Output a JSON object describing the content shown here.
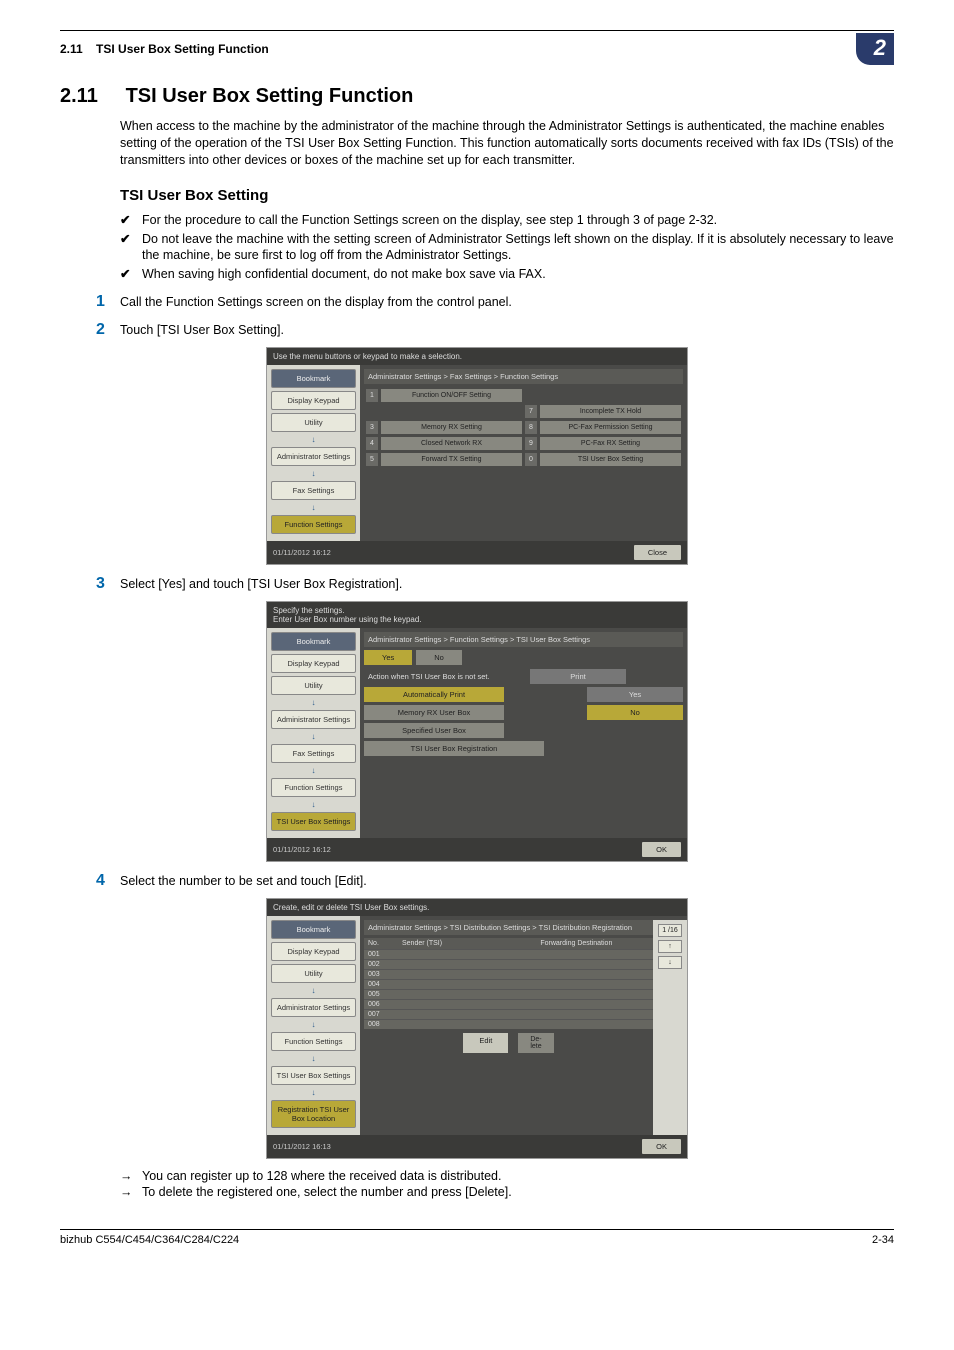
{
  "header": {
    "section_ref": "2.11",
    "section_name": "TSI User Box Setting Function",
    "chapter_badge": "2"
  },
  "title": {
    "number": "2.11",
    "text": "TSI User Box Setting Function"
  },
  "intro": "When access to the machine by the administrator of the machine through the Administrator Settings is authenticated, the machine enables setting of the operation of the TSI User Box Setting Function. This function automatically sorts documents received with fax IDs (TSIs) of the transmitters into other devices or boxes of the machine set up for each transmitter.",
  "subheading": "TSI User Box Setting",
  "checks": [
    "For the procedure to call the Function Settings screen on the display, see step 1 through 3 of page 2-32.",
    "Do not leave the machine with the setting screen of Administrator Settings left shown on the display. If it is absolutely necessary to leave the machine, be sure first to log off from the Administrator Settings.",
    "When saving high confidential document, do not make box save via FAX."
  ],
  "steps": {
    "s1": {
      "num": "1",
      "text": "Call the Function Settings screen on the display from the control panel."
    },
    "s2": {
      "num": "2",
      "text": "Touch [TSI User Box Setting]."
    },
    "s3": {
      "num": "3",
      "text": "Select [Yes] and touch [TSI User Box Registration]."
    },
    "s4": {
      "num": "4",
      "text": "Select the number to be set and touch [Edit]."
    }
  },
  "arrows": [
    "You can register up to 128 where the received data is distributed.",
    "To delete the registered one, select the number and press [Delete]."
  ],
  "ss1": {
    "top": "Use the menu buttons or keypad to make a selection.",
    "breadcrumb": "Administrator Settings > Fax Settings > Function Settings",
    "side": [
      "Bookmark",
      "Display Keypad",
      "Utility",
      "Administrator Settings",
      "Fax Settings",
      "Function Settings"
    ],
    "cells": {
      "c1": "Function ON/OFF Setting",
      "c2": "",
      "c3": "",
      "c7": "Incomplete TX Hold",
      "c4": "Memory RX Setting",
      "c8": "PC-Fax Permission Setting",
      "c5": "Closed Network RX",
      "c9": "PC-Fax RX Setting",
      "c6": "Forward TX Setting",
      "c0": "TSI User Box Setting"
    },
    "datetime": "01/11/2012   16:12",
    "close": "Close"
  },
  "ss2": {
    "top": "Specify the settings.\nEnter User Box number using the keypad.",
    "breadcrumb": "Administrator Settings > Function Settings > TSI User Box Settings",
    "side": [
      "Bookmark",
      "Display Keypad",
      "Utility",
      "Administrator Settings",
      "Fax Settings",
      "Function Settings",
      "TSI User Box Settings"
    ],
    "tabs": {
      "yes": "Yes",
      "no": "No"
    },
    "rows": {
      "r1_label": "Action when TSI User Box is not set.",
      "r1_val": "Print",
      "r2_btn": "Automatically Print",
      "r2_val": "Yes",
      "r3_btn": "Memory RX User Box",
      "r3_val": "No",
      "r4_btn": "Specified User Box",
      "r5_btn": "TSI User Box Registration"
    },
    "datetime": "01/11/2012   16:12",
    "ok": "OK"
  },
  "ss3": {
    "top": "Create, edit or delete TSI User Box settings.",
    "breadcrumb": "Administrator Settings > TSI Distribution Settings > TSI Distribution Registration",
    "side": [
      "Bookmark",
      "Display Keypad",
      "Utility",
      "Administrator Settings",
      "Function Settings",
      "TSI User Box Settings",
      "Registration TSI User Box Location"
    ],
    "thead": {
      "no": "No.",
      "sender": "Sender (TSI)",
      "dest": "Forwarding Destination"
    },
    "rows": [
      "001",
      "002",
      "003",
      "004",
      "005",
      "006",
      "007",
      "008"
    ],
    "pager": {
      "page": "1 /16",
      "up": "↑",
      "down": "↓"
    },
    "edit": "Edit",
    "delete": "De-\nlete",
    "datetime": "01/11/2012   16:13",
    "ok": "OK"
  },
  "footer": {
    "left": "bizhub C554/C454/C364/C284/C224",
    "right": "2-34"
  }
}
